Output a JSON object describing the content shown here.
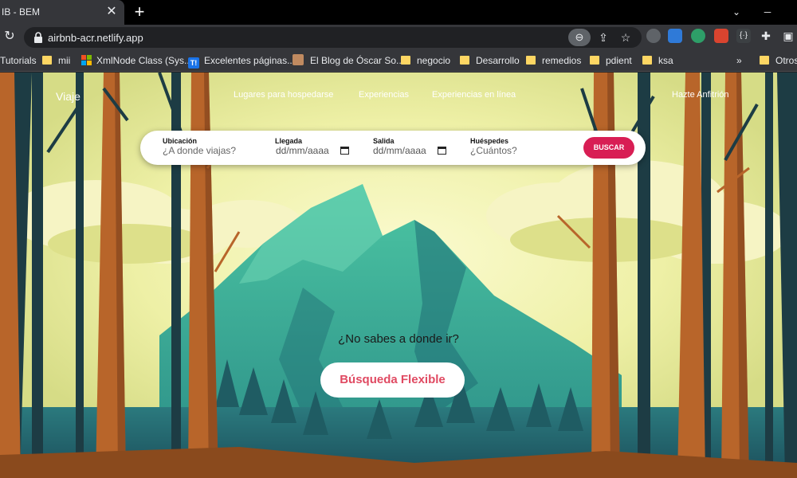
{
  "browser": {
    "tab_title": "IB - BEM",
    "tab_close": "✕",
    "new_tab": "+",
    "window_controls": {
      "minimize": "─",
      "maximize": "▢",
      "close": "✕"
    },
    "reload": "↻",
    "url": "airbnb-acr.netlify.app",
    "zoom_icon": "⊖",
    "share_icon": "⇪",
    "star_icon": "☆",
    "extension_puzzle": "✚",
    "sidebar_icon": "▣",
    "bookmarks": [
      {
        "label": "Tutorials",
        "icon": "none"
      },
      {
        "label": "mii",
        "icon": "folder"
      },
      {
        "label": "XmlNode Class (Sys...",
        "icon": "ms-logo"
      },
      {
        "label": "Excelentes páginas...",
        "icon": "t-icon"
      },
      {
        "label": "El Blog de Óscar So...",
        "icon": "face-icon"
      },
      {
        "label": "negocio",
        "icon": "folder"
      },
      {
        "label": "Desarrollo",
        "icon": "folder"
      },
      {
        "label": "remedios",
        "icon": "folder"
      },
      {
        "label": "pdient",
        "icon": "folder"
      },
      {
        "label": "ksa",
        "icon": "folder"
      }
    ],
    "bookmarks_overflow": "»",
    "other_bookmarks": "Otros"
  },
  "nav": {
    "logo": "Viaje",
    "links": [
      "Lugares para hospedarse",
      "Experiencias",
      "Experiencias en línea"
    ],
    "host": "Hazte Anfitrión"
  },
  "search": {
    "location_label": "Ubicación",
    "location_placeholder": "¿A donde viajas?",
    "checkin_label": "Llegada",
    "checkin_value": "dd/mm/aaaa",
    "checkout_label": "Salida",
    "checkout_value": "dd/mm/aaaa",
    "guests_label": "Huéspedes",
    "guests_placeholder": "¿Cuántos?",
    "button": "BUSCAR"
  },
  "hero": {
    "question": "¿No sabes a donde ir?",
    "button": "Búsqueda Flexible"
  },
  "colors": {
    "accent": "#d81e54",
    "flex_text": "#e04a62",
    "sky": "#e9ec9c",
    "mountain": "#3aa58c",
    "tree_trunk": "#b8652a",
    "tree_dark": "#1d3c44"
  }
}
